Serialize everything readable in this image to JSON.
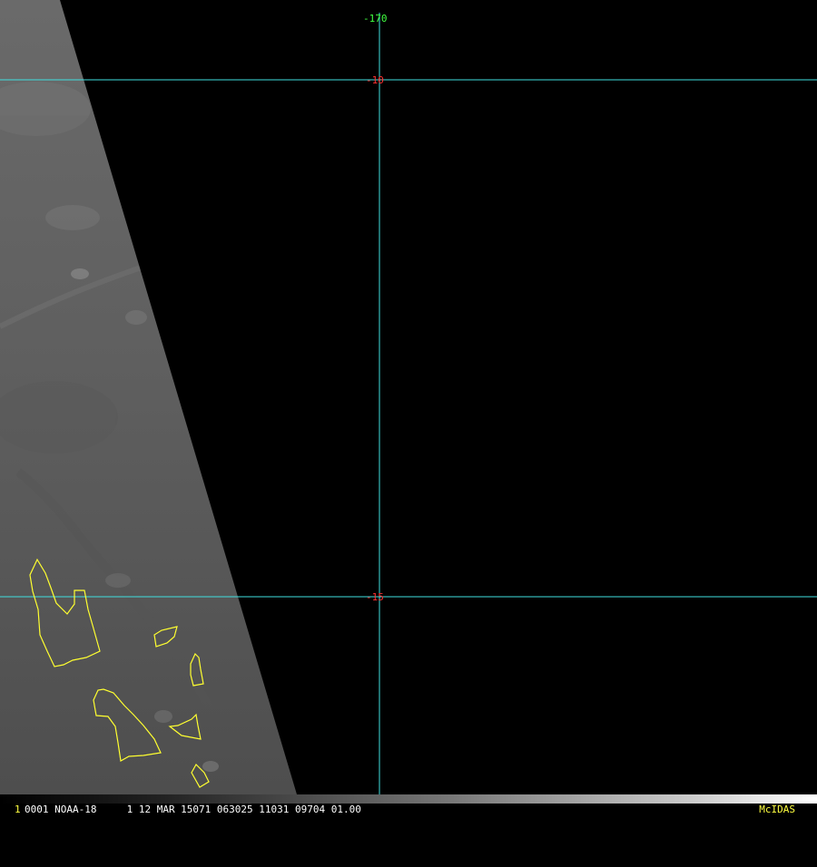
{
  "map": {
    "longitude_labels": [
      {
        "value": "-170",
        "color": "#40ff40"
      }
    ],
    "latitude_labels": [
      {
        "value": "-10",
        "color": "#ff3030"
      },
      {
        "value": "-15",
        "color": "#ff3030"
      }
    ],
    "grid_color": "#40e0e0",
    "coastline_color": "#ffff30",
    "feature_labels": []
  },
  "status_bar": {
    "frame_number": "1",
    "info": "0001 NOAA-18     1 12 MAR 15071 063025 11031 09704 01.00",
    "logo": "McIDAS"
  }
}
